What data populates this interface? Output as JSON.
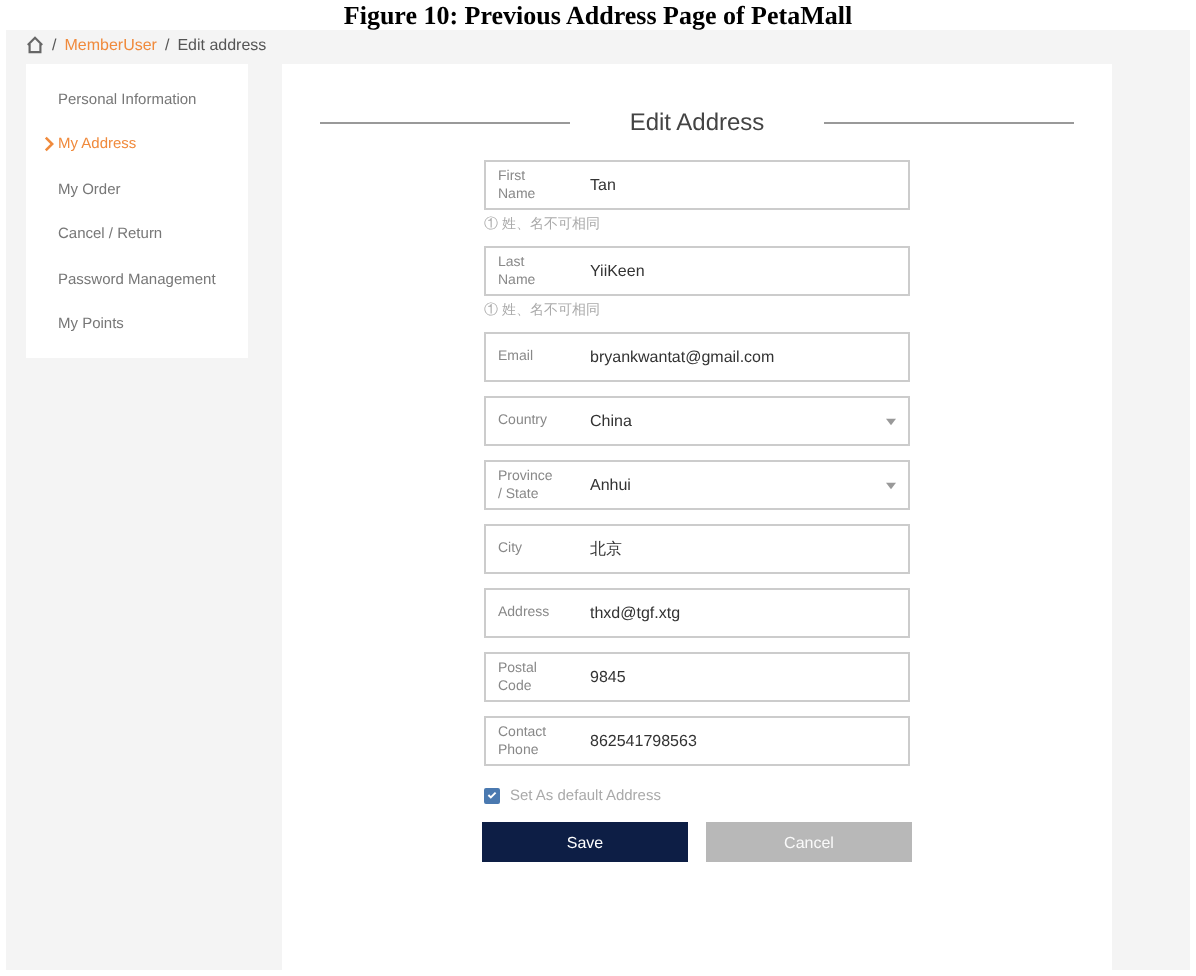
{
  "caption": "Figure 10: Previous Address Page of PetaMall",
  "breadcrumb": {
    "separator": "/",
    "items": [
      {
        "label": "MemberUser",
        "kind": "link"
      },
      {
        "label": "Edit address",
        "kind": "current"
      }
    ]
  },
  "sidebar": {
    "items": [
      {
        "label": "Personal Information",
        "selected": false
      },
      {
        "label": "My Address",
        "selected": true
      },
      {
        "label": "My Order",
        "selected": false
      },
      {
        "label": "Cancel / Return",
        "selected": false
      },
      {
        "label": "Password Management",
        "selected": false
      },
      {
        "label": "My Points",
        "selected": false
      }
    ]
  },
  "form": {
    "title": "Edit Address",
    "fields": [
      {
        "kind": "text",
        "label": "First Name",
        "value": "Tan",
        "hint": "① 姓、名不可相同"
      },
      {
        "kind": "text",
        "label": "Last Name",
        "value": "YiiKeen",
        "hint": "① 姓、名不可相同"
      },
      {
        "kind": "text",
        "label": "Email",
        "value": "bryankwantat@gmail.com"
      },
      {
        "kind": "select",
        "label": "Country",
        "value": "China"
      },
      {
        "kind": "select",
        "label": "Province / State",
        "value": "Anhui"
      },
      {
        "kind": "text",
        "label": "City",
        "value": "北京"
      },
      {
        "kind": "text",
        "label": "Address",
        "value": "thxd@tgf.xtg"
      },
      {
        "kind": "text",
        "label": "Postal Code",
        "value": "9845"
      },
      {
        "kind": "text",
        "label": "Contact Phone",
        "value": "862541798563"
      }
    ],
    "default_address": {
      "label": "Set As default Address",
      "checked": true
    },
    "buttons": [
      {
        "label": "Save",
        "disabled": false
      },
      {
        "label": "Cancel",
        "disabled": true
      }
    ]
  }
}
